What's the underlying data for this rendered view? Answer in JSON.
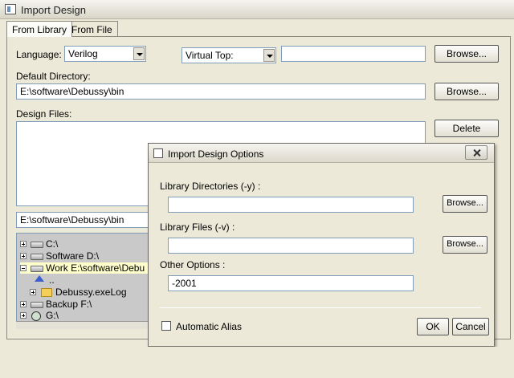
{
  "window": {
    "title": "Import Design"
  },
  "tabs": [
    {
      "label": "From Library"
    },
    {
      "label": "From File"
    }
  ],
  "main": {
    "language_label": "Language:",
    "language_value": "Verilog",
    "virtual_top_label": "Virtual Top:",
    "virtual_top_value": "",
    "browse_label": "Browse...",
    "default_directory_label": "Default Directory:",
    "default_directory_value": "E:\\software\\Debussy\\bin",
    "design_files_label": "Design Files:",
    "delete_label": "Delete",
    "current_dir_value": "E:\\software\\Debussy\\bin"
  },
  "tree": {
    "items": [
      {
        "label": "C:\\"
      },
      {
        "label": "Software D:\\"
      },
      {
        "label": "Work E:\\software\\Debu"
      },
      {
        "label": ".."
      },
      {
        "label": "Debussy.exeLog"
      },
      {
        "label": "Backup F:\\"
      },
      {
        "label": "G:\\"
      }
    ]
  },
  "dialog": {
    "title": "Import Design Options",
    "library_directories_label": "Library Directories (-y) :",
    "library_directories_value": "",
    "library_files_label": "Library Files (-v) :",
    "library_files_value": "",
    "other_options_label": "Other Options :",
    "other_options_value": "-2001",
    "browse_label": "Browse...",
    "automatic_alias_label": "Automatic Alias",
    "ok_label": "OK",
    "cancel_label": "Cancel"
  },
  "colors": {
    "window_bg": "#ece9d8",
    "tree_bg": "#c9c9c9",
    "highlight": "#ffffcc",
    "field_border": "#7f9db9"
  }
}
